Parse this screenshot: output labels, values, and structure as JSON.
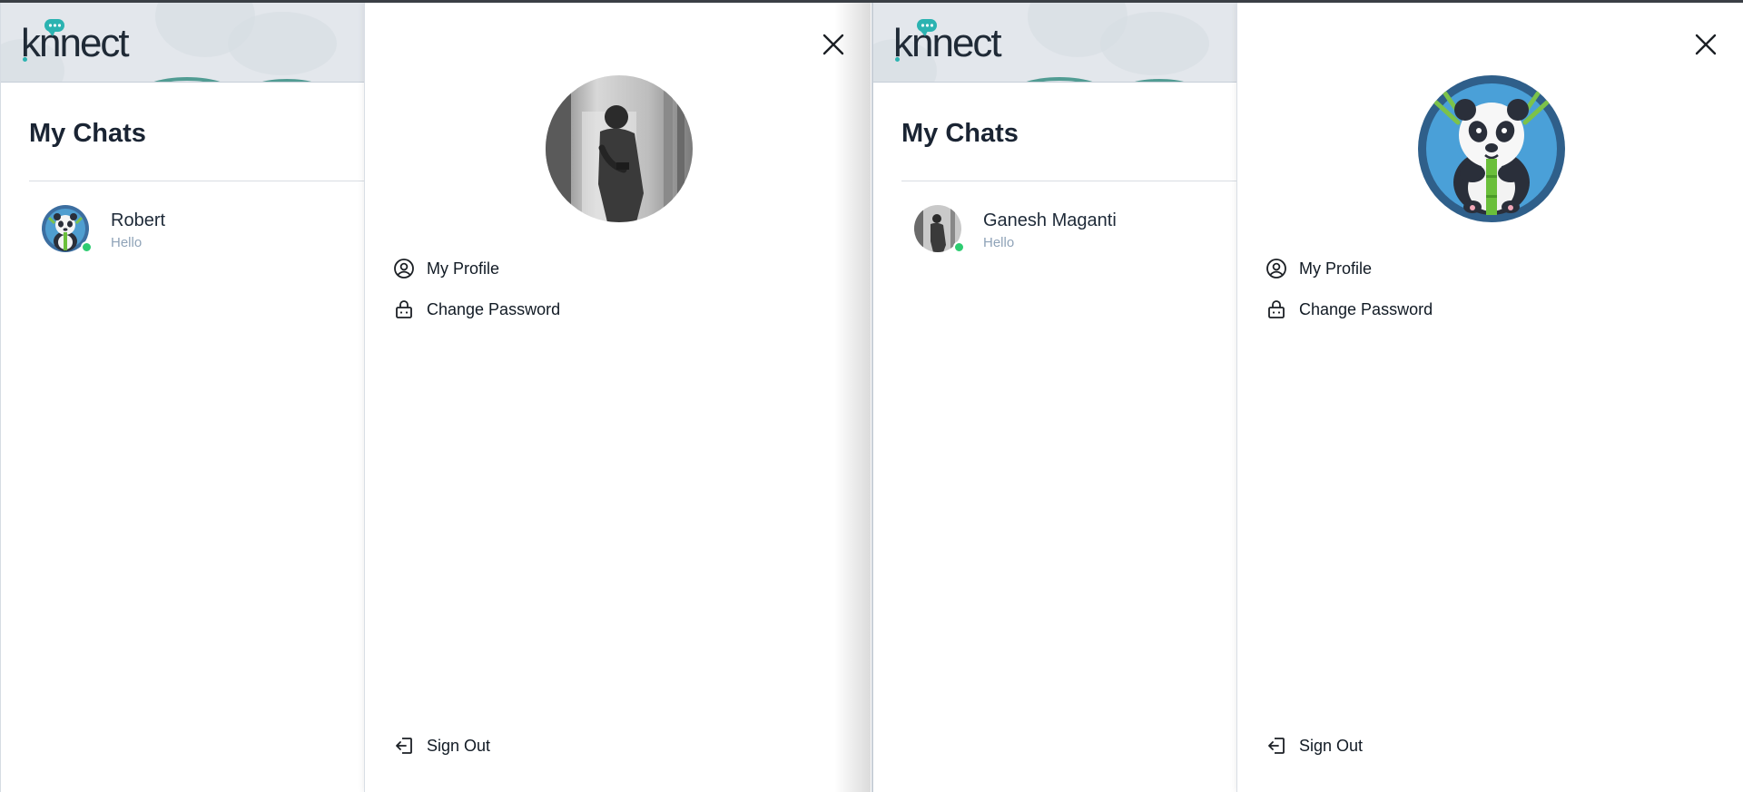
{
  "left_screen": {
    "app": {
      "logo_text": "knnect"
    },
    "chat_list": {
      "title": "My Chats",
      "items": [
        {
          "name": "Robert",
          "preview": "Hello",
          "online": true,
          "avatar_icon": "panda-avatar"
        }
      ]
    },
    "profile_drawer": {
      "avatar_icon": "person-photo-avatar",
      "menu": [
        {
          "label": "My Profile",
          "icon": "user-circle-icon"
        },
        {
          "label": "Change Password",
          "icon": "lock-icon"
        }
      ],
      "sign_out_label": "Sign Out"
    }
  },
  "right_screen": {
    "app": {
      "logo_text": "knnect"
    },
    "chat_list": {
      "title": "My Chats",
      "items": [
        {
          "name": "Ganesh Maganti",
          "preview": "Hello",
          "online": true,
          "avatar_icon": "person-photo-avatar"
        }
      ]
    },
    "profile_drawer": {
      "avatar_icon": "panda-avatar",
      "menu": [
        {
          "label": "My Profile",
          "icon": "user-circle-icon"
        },
        {
          "label": "Change Password",
          "icon": "lock-icon"
        }
      ],
      "sign_out_label": "Sign Out"
    }
  },
  "colors": {
    "online": "#2ecc71",
    "brand_teal": "#2bb3b1",
    "header_bg": "#e3e7ec",
    "preview_text": "#8fa3b8"
  }
}
